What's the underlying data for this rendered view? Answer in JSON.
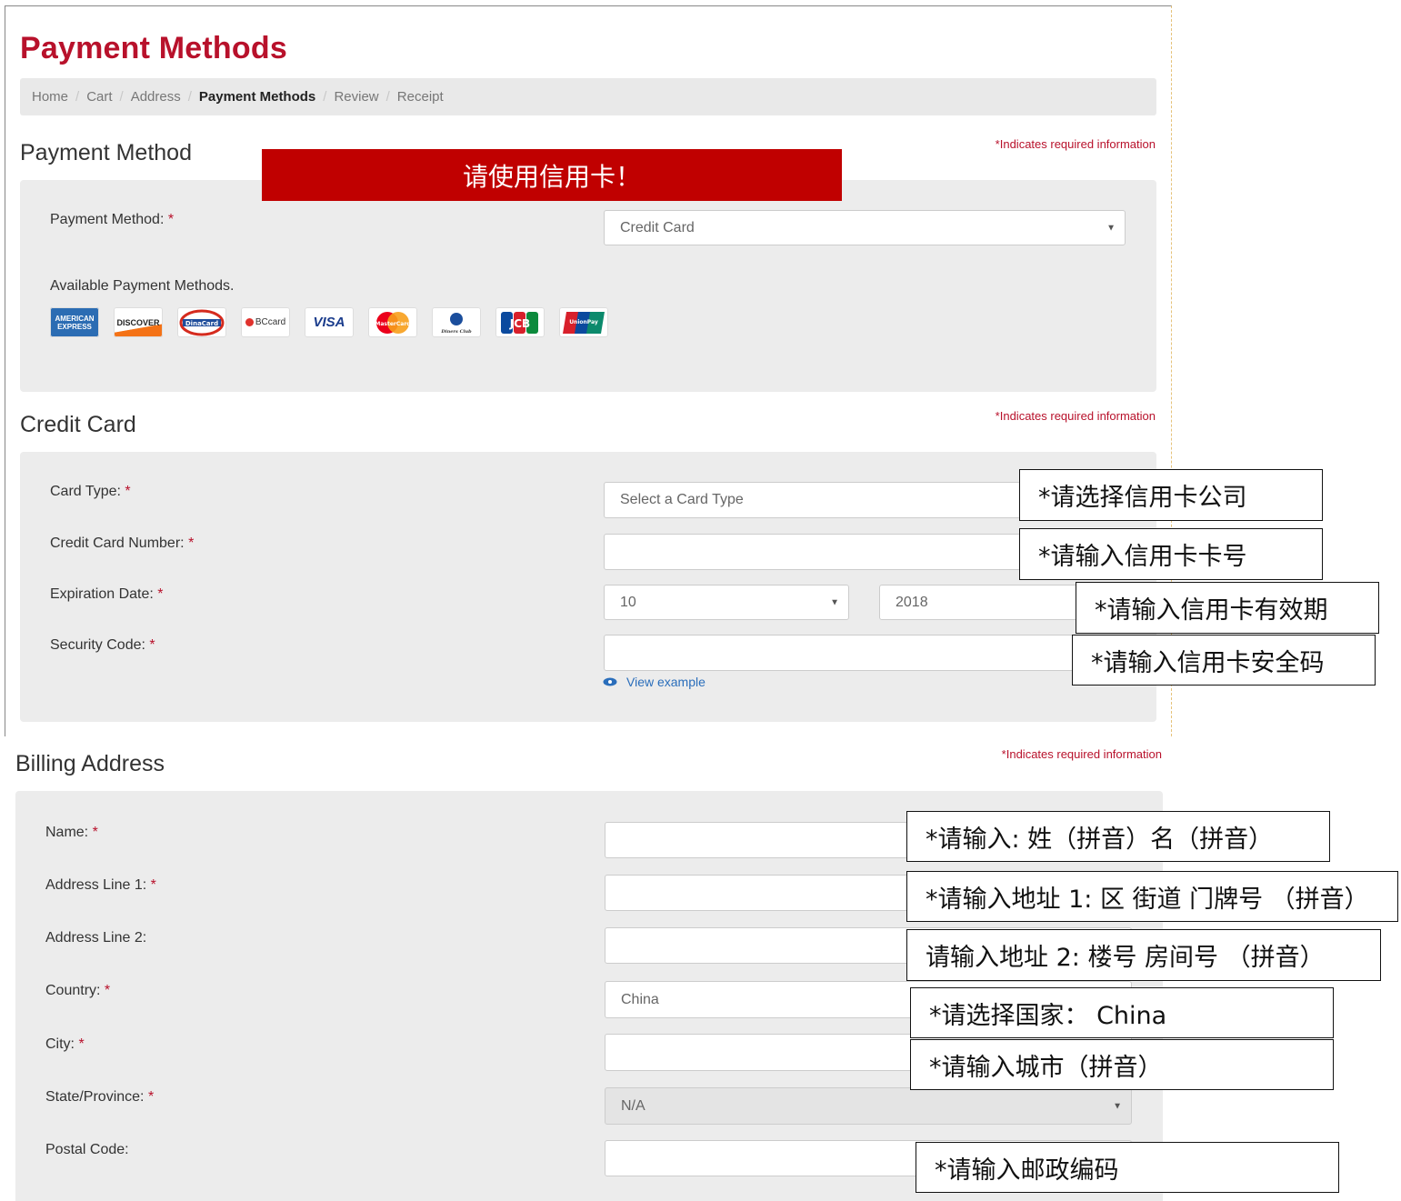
{
  "page": {
    "title": "Payment Methods",
    "accent": "#b8112b"
  },
  "breadcrumb": [
    "Home",
    "Cart",
    "Address",
    "Payment Methods",
    "Review",
    "Receipt"
  ],
  "required_note": "*Indicates required information",
  "payment_section": {
    "title": "Payment Method",
    "method_label": "Payment Method:",
    "method_value": "Credit Card",
    "available_label": "Available Payment Methods.",
    "card_brands": [
      "American Express",
      "Discover",
      "DinaCard",
      "BCcard",
      "VISA",
      "MasterCard",
      "Diners Club International",
      "JCB",
      "UnionPay"
    ]
  },
  "banner": "请使用信用卡！",
  "credit_card_section": {
    "title": "Credit Card",
    "card_type_label": "Card Type:",
    "card_type_placeholder": "Select a Card Type",
    "number_label": "Credit Card Number:",
    "expiration_label": "Expiration Date:",
    "exp_month": "10",
    "exp_year": "2018",
    "security_label": "Security Code:",
    "view_example": "View example"
  },
  "billing_section": {
    "title": "Billing Address",
    "name_label": "Name:",
    "address1_label": "Address Line 1:",
    "address2_label": "Address Line 2:",
    "country_label": "Country:",
    "country_value": "China",
    "city_label": "City:",
    "state_label": "State/Province:",
    "state_value": "N/A",
    "postal_label": "Postal Code:"
  },
  "annotations": {
    "card_type": "*请选择信用卡公司",
    "card_number": "*请输入信用卡卡号",
    "expiration": "*请输入信用卡有效期",
    "security": "*请输入信用卡安全码",
    "name": "*请输入: 姓（拼音）名（拼音）",
    "address1": "*请输入地址 1: 区 街道 门牌号 （拼音）",
    "address2": "请输入地址 2: 楼号 房间号 （拼音）",
    "country": "*请选择国家： China",
    "city": "*请输入城市（拼音）",
    "postal": "*请输入邮政编码"
  }
}
